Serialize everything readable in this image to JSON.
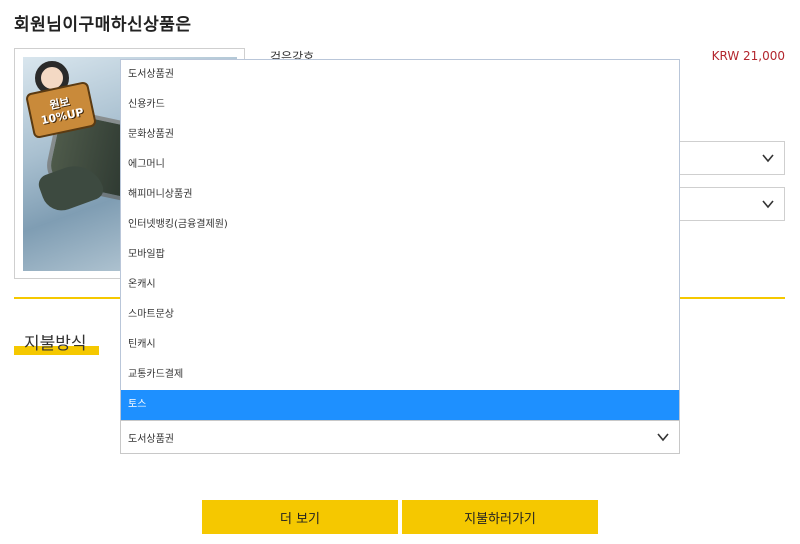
{
  "page": {
    "title": "회원님이구매하신상품은"
  },
  "product": {
    "name": "검은강호",
    "price": "KRW 21,000",
    "badge": {
      "line1": "원보",
      "line2": "10%UP"
    }
  },
  "payment": {
    "heading": "지불방식",
    "selected_value": "도서상품권",
    "options": [
      "도서상품권",
      "신용카드",
      "문화상품권",
      "에그머니",
      "해피머니상품권",
      "인터넷뱅킹(금융결제원)",
      "모바일팝",
      "온캐시",
      "스마트문상",
      "틴캐시",
      "교통카드결제",
      "토스"
    ],
    "highlighted_option": "토스"
  },
  "buttons": {
    "more": "더 보기",
    "go_pay": "지불하러가기"
  },
  "colors": {
    "accent": "#f5c800",
    "price": "#b3262e",
    "highlight": "#1e90ff"
  }
}
